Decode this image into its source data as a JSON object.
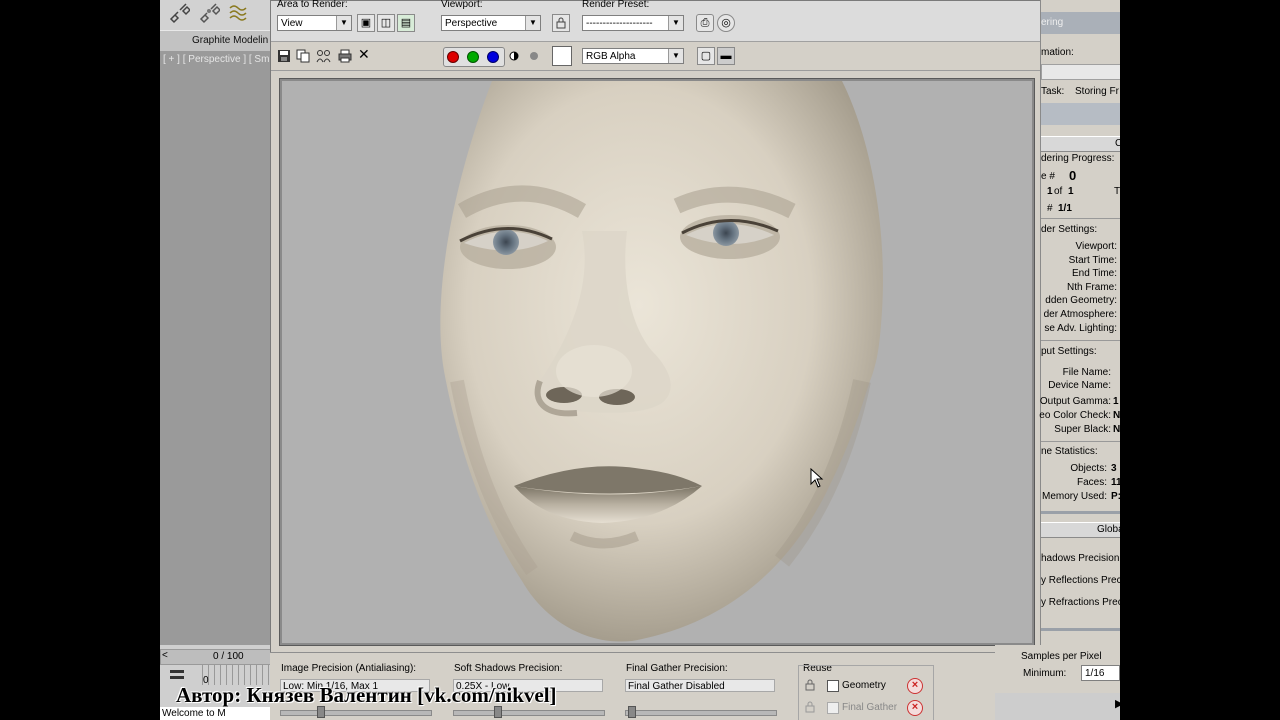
{
  "toolbar": {
    "area_label": "Area to Render:",
    "area_value": "View",
    "viewport_label": "Viewport:",
    "viewport_value": "Perspective",
    "preset_label": "Render Preset:",
    "preset_value": "--------------------",
    "channel_value": "RGB Alpha",
    "clear_icon": "✕"
  },
  "left_panel": {
    "ribbon_label": "Graphite Modelin",
    "viewport_label": "[ + ] [ Perspective ] [ Sm",
    "time_counter": "0 / 100",
    "welcome": "Welcome to M",
    "frame_zero": "0"
  },
  "bottom": {
    "image_precision_label": "Image Precision (Antialiasing):",
    "image_precision_value": "Low: Min 1/16, Max 1",
    "soft_shadows_label": "Soft Shadows Precision:",
    "soft_shadows_value": "0.25X - Low",
    "final_gather_label": "Final Gather Precision:",
    "final_gather_value": "Final Gather Disabled",
    "reuse_label": "Reuse",
    "geometry_label": "Geometry",
    "final_gather_reuse_label": "Final Gather",
    "samples_label": "Samples per Pixel",
    "minimum_label": "Minimum:",
    "minimum_value": "1/16"
  },
  "right_panel": {
    "title_fragment": "ering",
    "animation_label": "mation:",
    "task_label": "Task:",
    "task_value": "Storing Fr",
    "progress_label": "dering Progress:",
    "frame_label": "e #",
    "frame_value": "0",
    "of_value_a": "1",
    "of_word": "of",
    "of_value_b": "1",
    "t_fragment": "T",
    "pass_label": "#",
    "pass_value": "1/1",
    "render_settings_label": "der Settings:",
    "settings": [
      {
        "label": "Viewport:"
      },
      {
        "label": "Start Time:"
      },
      {
        "label": "End Time:"
      },
      {
        "label": "Nth Frame:"
      },
      {
        "label": "dden Geometry:"
      },
      {
        "label": "der Atmosphere:"
      },
      {
        "label": "se Adv. Lighting:"
      }
    ],
    "output_settings_label": "put Settings:",
    "output": [
      {
        "label": "File Name:",
        "value": ""
      },
      {
        "label": "Device Name:",
        "value": ""
      },
      {
        "label": "Output Gamma:",
        "value": "1"
      },
      {
        "label": "eo Color Check:",
        "value": "N"
      },
      {
        "label": "Super Black:",
        "value": "N"
      }
    ],
    "scene_stats_label": "ne Statistics:",
    "stats": [
      {
        "label": "Objects:",
        "value": "3"
      },
      {
        "label": "Faces:",
        "value": "11"
      },
      {
        "label": "Memory Used:",
        "value": "P:"
      }
    ],
    "global_label": "Globa",
    "precision_items": [
      {
        "label": "hadows Precision"
      },
      {
        "label": "y Reflections Prec"
      },
      {
        "label": "y Refractions Prec"
      }
    ],
    "c_fragment": "C"
  },
  "watermark": "Автор: Князев Валентин [vk.com/nikvel]",
  "colors": {
    "render_bg": "#b1b1b1",
    "skin": "#d9d2c4",
    "eye": "#5f6d78"
  }
}
